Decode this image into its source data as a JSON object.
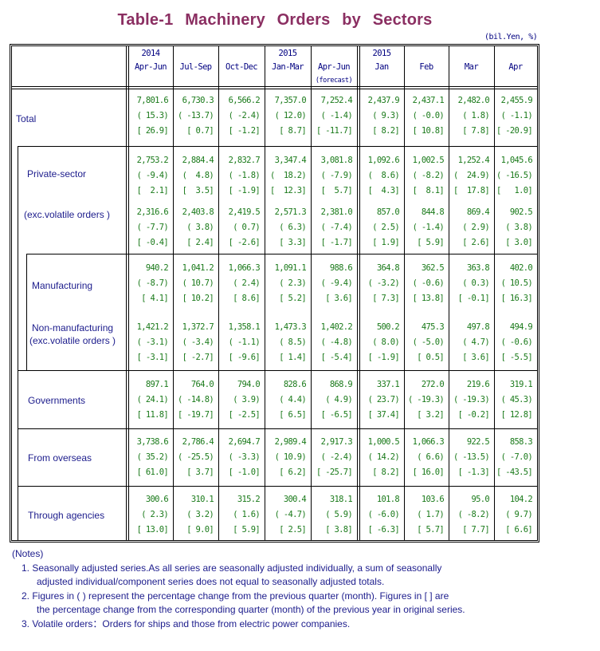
{
  "title": "Table-1  Machinery  Orders  by  Sectors",
  "units": "(bil.Yen, %)",
  "columns": [
    {
      "year": "2014",
      "period": "Apr-Jun",
      "note": ""
    },
    {
      "year": "",
      "period": "Jul-Sep",
      "note": ""
    },
    {
      "year": "",
      "period": "Oct-Dec",
      "note": ""
    },
    {
      "year": "2015",
      "period": "Jan-Mar",
      "note": ""
    },
    {
      "year": "",
      "period": "Apr-Jun",
      "note": "(forecast)"
    },
    {
      "year": "2015",
      "period": "Jan",
      "note": ""
    },
    {
      "year": "",
      "period": "Feb",
      "note": ""
    },
    {
      "year": "",
      "period": "Mar",
      "note": ""
    },
    {
      "year": "",
      "period": "Apr",
      "note": ""
    }
  ],
  "rows": [
    {
      "label": "Total",
      "values": [
        [
          "7,801.6",
          "( 15.3)",
          "[ 26.9]"
        ],
        [
          "6,730.3",
          "( -13.7)",
          "[ 0.7]"
        ],
        [
          "6,566.2",
          "( -2.4)",
          "[ -1.2]"
        ],
        [
          "7,357.0",
          "( 12.0)",
          "[ 8.7]"
        ],
        [
          "7,252.4",
          "( -1.4)",
          "[ -11.7]"
        ],
        [
          "2,437.9",
          "( 9.3)",
          "[ 8.2]"
        ],
        [
          "2,437.1",
          "( -0.0)",
          "[ 10.8]"
        ],
        [
          "2,482.0",
          "( 1.8)",
          "[ 7.8]"
        ],
        [
          "2,455.9",
          "( -1.1)",
          "[ -20.9]"
        ]
      ]
    },
    {
      "label": "Private-sector",
      "values": [
        [
          "2,753.2",
          "( -9.4)",
          "[  2.1]"
        ],
        [
          "2,884.4",
          "(  4.8)",
          "[  3.5]"
        ],
        [
          "2,832.7",
          "( -1.8)",
          "[ -1.9]"
        ],
        [
          "3,347.4",
          "(  18.2)",
          "[  12.3]"
        ],
        [
          "3,081.8",
          "( -7.9)",
          "[  5.7]"
        ],
        [
          "1,092.6",
          "(  8.6)",
          "[  4.3]"
        ],
        [
          "1,002.5",
          "( -8.2)",
          "[  8.1]"
        ],
        [
          "1,252.4",
          "(  24.9)",
          "[  17.8]"
        ],
        [
          "1,045.6",
          "( -16.5)",
          "[   1.0]"
        ]
      ]
    },
    {
      "label": "(exc.volatile orders )",
      "values": [
        [
          "2,316.6",
          "( -7.7)",
          "[ -0.4]"
        ],
        [
          "2,403.8",
          "( 3.8)",
          "[ 2.4]"
        ],
        [
          "2,419.5",
          "( 0.7)",
          "[ -2.6]"
        ],
        [
          "2,571.3",
          "( 6.3)",
          "[ 3.3]"
        ],
        [
          "2,381.0",
          "( -7.4)",
          "[ -1.7]"
        ],
        [
          "857.0",
          "( 2.5)",
          "[ 1.9]"
        ],
        [
          "844.8",
          "( -1.4)",
          "[ 5.9]"
        ],
        [
          "869.4",
          "( 2.9)",
          "[ 2.6]"
        ],
        [
          "902.5",
          "( 3.8)",
          "[ 3.0]"
        ]
      ]
    },
    {
      "label": "Manufacturing",
      "values": [
        [
          "940.2",
          "( -8.7)",
          "[ 4.1]"
        ],
        [
          "1,041.2",
          "( 10.7)",
          "[ 10.2]"
        ],
        [
          "1,066.3",
          "( 2.4)",
          "[ 8.6]"
        ],
        [
          "1,091.1",
          "( 2.3)",
          "[ 5.2]"
        ],
        [
          "988.6",
          "( -9.4)",
          "[ 3.6]"
        ],
        [
          "364.8",
          "( -3.2)",
          "[ 7.3]"
        ],
        [
          "362.5",
          "( -0.6)",
          "[ 13.8]"
        ],
        [
          "363.8",
          "( 0.3)",
          "[ -0.1]"
        ],
        [
          "402.0",
          "( 10.5)",
          "[ 16.3]"
        ]
      ]
    },
    {
      "label": "Non-manufacturing",
      "label2": "(exc.volatile orders )",
      "values": [
        [
          "1,421.2",
          "( -3.1)",
          "[ -3.1]"
        ],
        [
          "1,372.7",
          "( -3.4)",
          "[ -2.7]"
        ],
        [
          "1,358.1",
          "( -1.1)",
          "[ -9.6]"
        ],
        [
          "1,473.3",
          "( 8.5)",
          "[ 1.4]"
        ],
        [
          "1,402.2",
          "( -4.8)",
          "[ -5.4]"
        ],
        [
          "500.2",
          "( 8.0)",
          "[ -1.9]"
        ],
        [
          "475.3",
          "( -5.0)",
          "[ 0.5]"
        ],
        [
          "497.8",
          "( 4.7)",
          "[ 3.6]"
        ],
        [
          "494.9",
          "( -0.6)",
          "[ -5.5]"
        ]
      ]
    },
    {
      "label": "Governments",
      "values": [
        [
          "897.1",
          "( 24.1)",
          "[ 11.8]"
        ],
        [
          "764.0",
          "( -14.8)",
          "[ -19.7]"
        ],
        [
          "794.0",
          "( 3.9)",
          "[ -2.5]"
        ],
        [
          "828.6",
          "( 4.4)",
          "[ 6.5]"
        ],
        [
          "868.9",
          "( 4.9)",
          "[ -6.5]"
        ],
        [
          "337.1",
          "( 23.7)",
          "[ 37.4]"
        ],
        [
          "272.0",
          "( -19.3)",
          "[ 3.2]"
        ],
        [
          "219.6",
          "( -19.3)",
          "[ -0.2]"
        ],
        [
          "319.1",
          "( 45.3)",
          "[ 12.8]"
        ]
      ]
    },
    {
      "label": "From overseas",
      "values": [
        [
          "3,738.6",
          "( 35.2)",
          "[ 61.0]"
        ],
        [
          "2,786.4",
          "( -25.5)",
          "[ 3.7]"
        ],
        [
          "2,694.7",
          "( -3.3)",
          "[ -1.0]"
        ],
        [
          "2,989.4",
          "( 10.9)",
          "[ 6.2]"
        ],
        [
          "2,917.3",
          "( -2.4)",
          "[ -25.7]"
        ],
        [
          "1,000.5",
          "( 14.2)",
          "[ 8.2]"
        ],
        [
          "1,066.3",
          "( 6.6)",
          "[ 16.0]"
        ],
        [
          "922.5",
          "( -13.5)",
          "[ -1.3]"
        ],
        [
          "858.3",
          "( -7.0)",
          "[ -43.5]"
        ]
      ]
    },
    {
      "label": "Through agencies",
      "values": [
        [
          "300.6",
          "( 2.3)",
          "[ 13.0]"
        ],
        [
          "310.1",
          "( 3.2)",
          "[ 9.0]"
        ],
        [
          "315.2",
          "( 1.6)",
          "[ 5.9]"
        ],
        [
          "300.4",
          "( -4.7)",
          "[ 2.5]"
        ],
        [
          "318.1",
          "( 5.9)",
          "[ 3.8]"
        ],
        [
          "101.8",
          "( -6.0)",
          "[ -6.3]"
        ],
        [
          "103.6",
          "( 1.7)",
          "[ 5.7]"
        ],
        [
          "95.0",
          "( -8.2)",
          "[ 7.7]"
        ],
        [
          "104.2",
          "( 9.7)",
          "[ 6.6]"
        ]
      ]
    }
  ],
  "notes": {
    "heading": "(Notes)",
    "items": [
      {
        "line1": "1. Seasonally adjusted series.As all series are seasonally adjusted individually, a sum of seasonally",
        "line2": "adjusted individual/component series does not equal to seasonally adjusted totals."
      },
      {
        "line1": "2. Figures in ( ) represent the percentage change from the previous quarter (month). Figures in [ ] are",
        "line2": "the percentage change from the corresponding quarter (month) of the previous year in original series."
      },
      {
        "line1": "3. Volatile orders：Orders for ships and those from electric power companies.",
        "line2": ""
      }
    ]
  }
}
